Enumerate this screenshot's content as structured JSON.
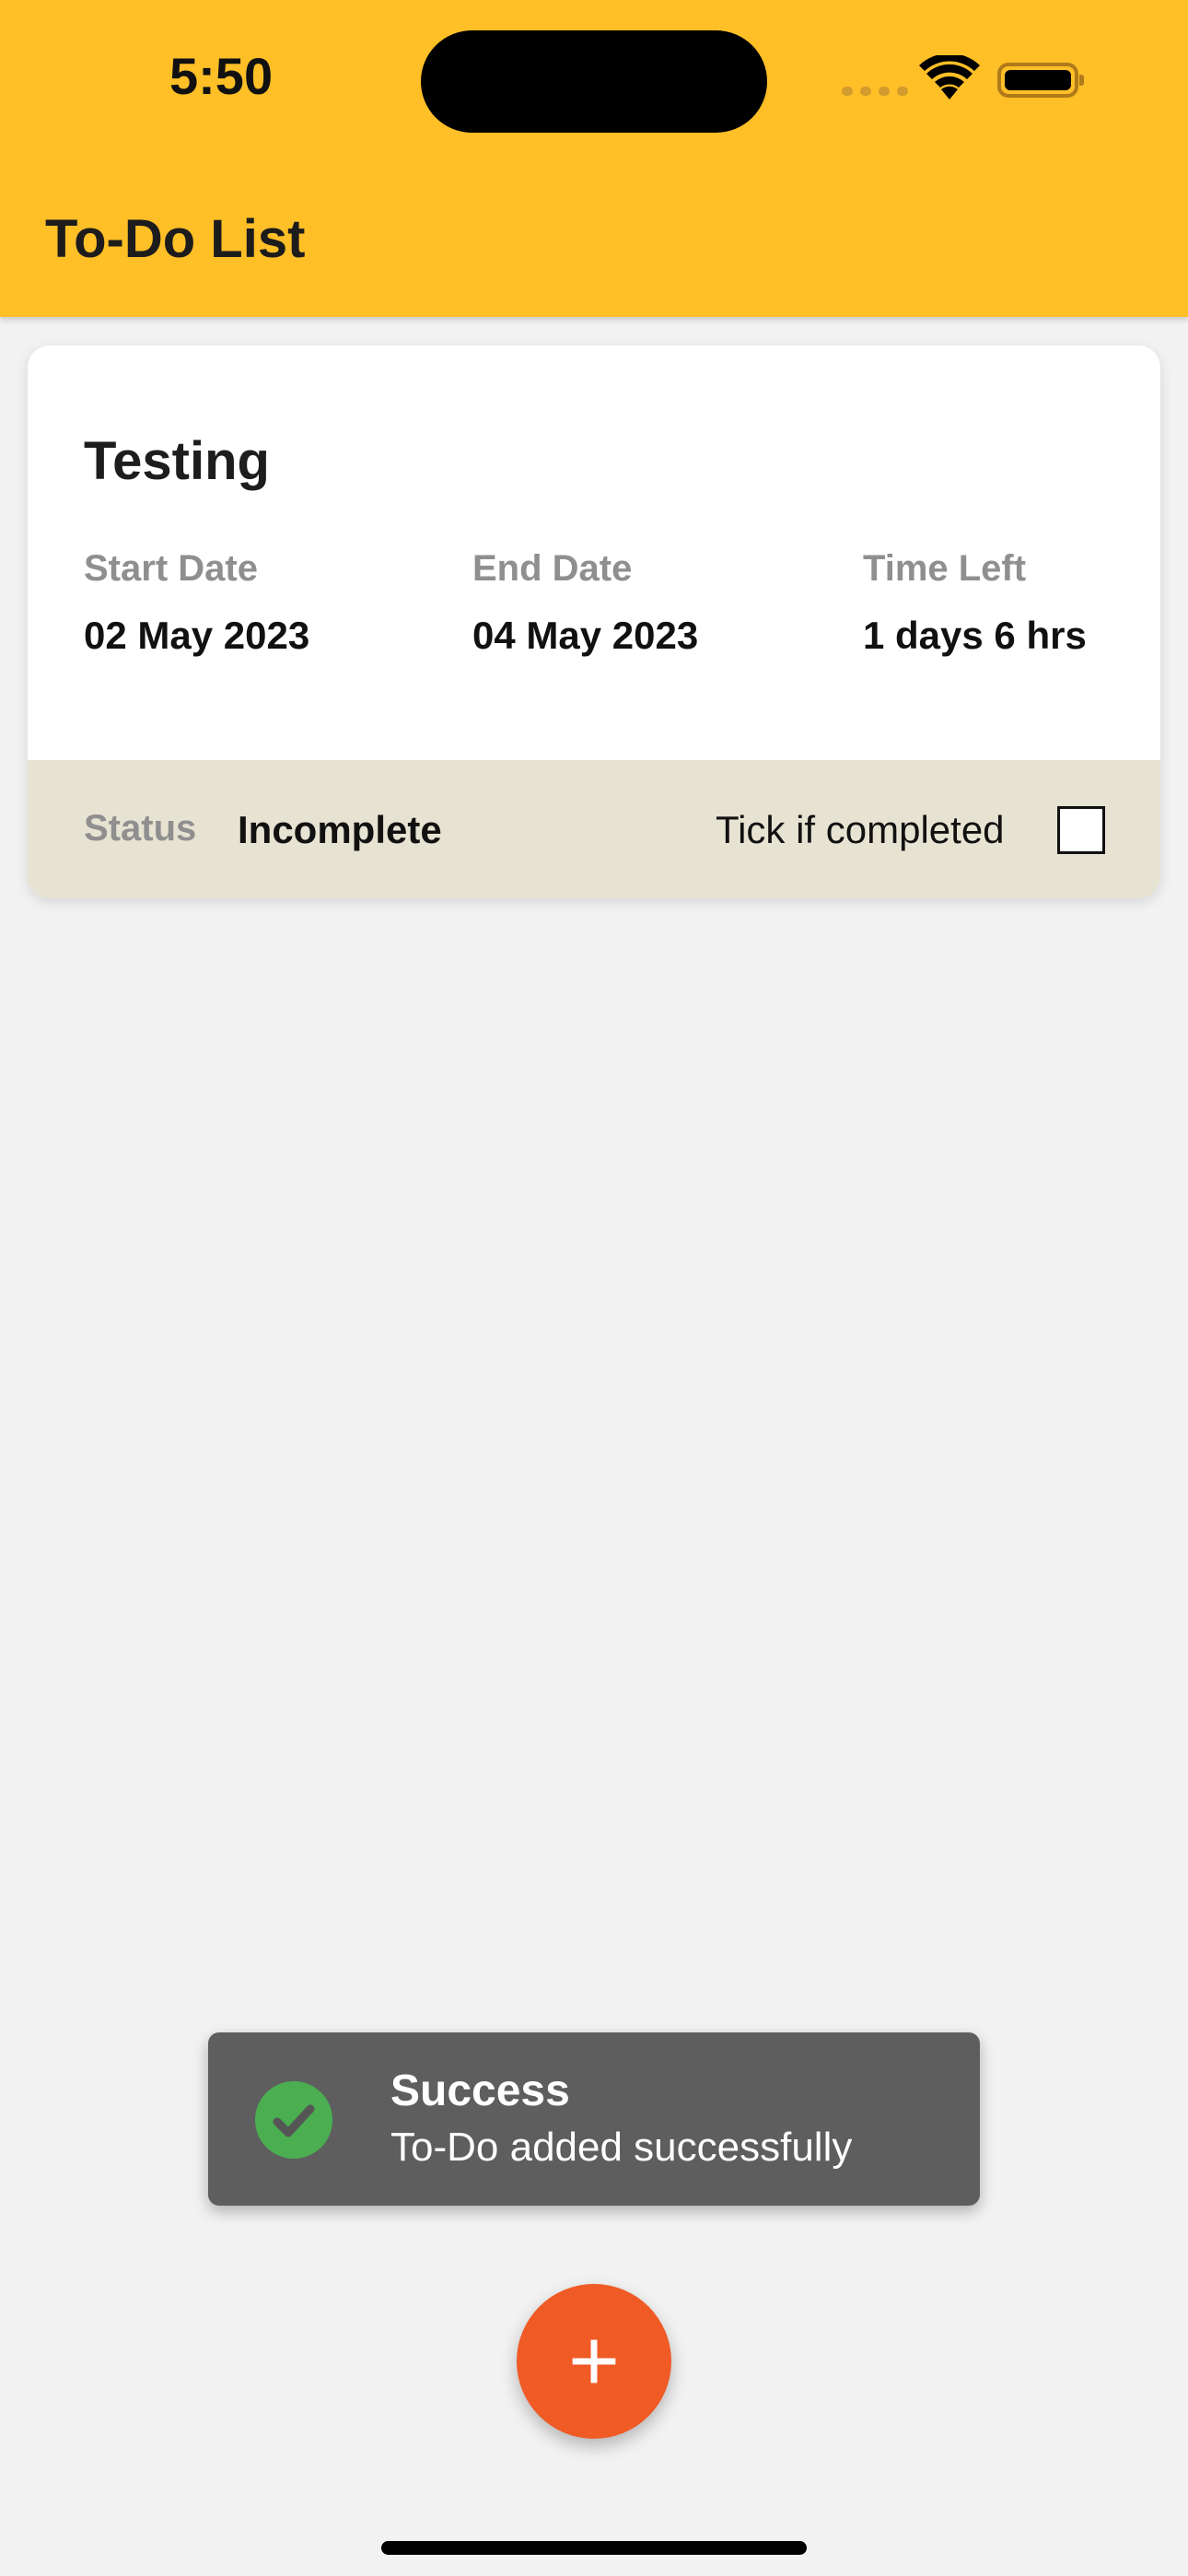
{
  "status_bar": {
    "time": "5:50",
    "icons": [
      "cellular-signal-icon",
      "wifi-icon",
      "battery-icon"
    ]
  },
  "header": {
    "title": "To-Do List",
    "color": "#ffbf27"
  },
  "todo_list": [
    {
      "title": "Testing",
      "start_date_label": "Start Date",
      "start_date": "02 May 2023",
      "end_date_label": "End Date",
      "end_date": "04 May 2023",
      "time_left_label": "Time Left",
      "time_left": "1 days 6 hrs",
      "status_label": "Status",
      "status": "Incomplete",
      "complete_label": "Tick if completed",
      "completed": false
    }
  ],
  "toast": {
    "title": "Success",
    "message": "To-Do added successfully",
    "icon": "success-check-icon",
    "color": "#4bae50"
  },
  "fab": {
    "label": "+",
    "icon": "plus-icon",
    "color": "#f05a25"
  }
}
